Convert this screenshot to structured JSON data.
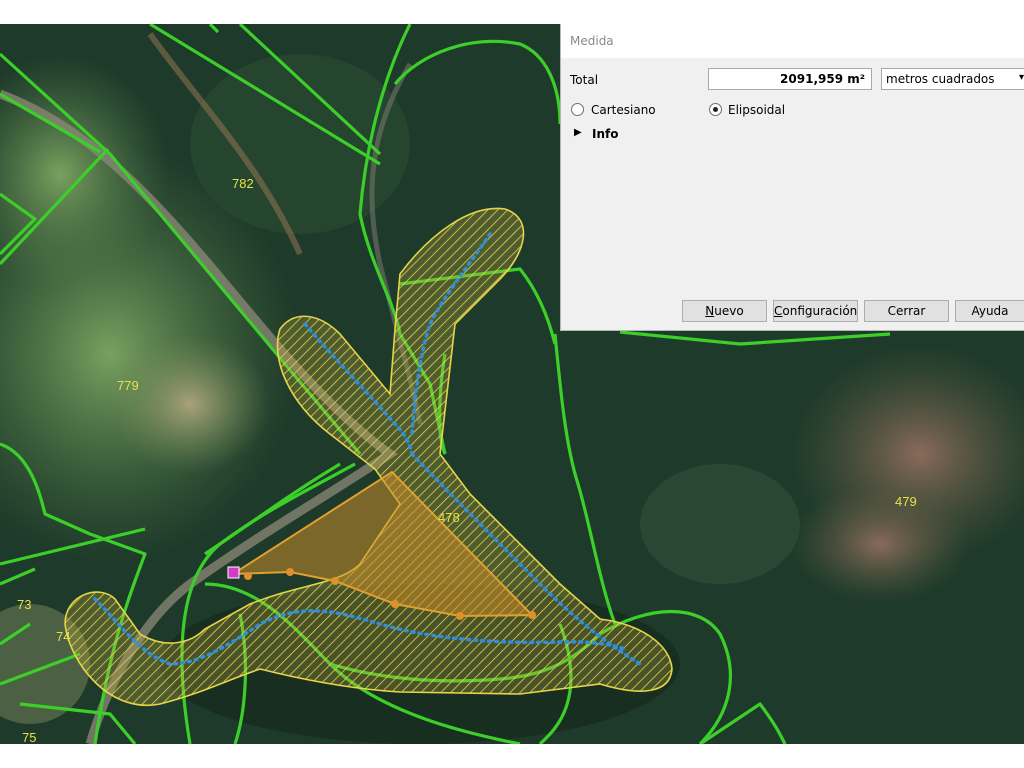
{
  "map": {
    "parcel_labels": [
      "782",
      "779",
      "478",
      "479",
      "73",
      "74",
      "75"
    ]
  },
  "dialog": {
    "title": "Medida",
    "total_label": "Total",
    "total_value": "2091,959 m²",
    "unit_selected": "metros cuadrados",
    "radio_cartesian": "Cartesiano",
    "radio_ellipsoidal": "Elipsoidal",
    "selected_mode": "Elipsoidal",
    "info_label": "Info",
    "buttons": {
      "new": {
        "mnemonic": "N",
        "rest": "uevo"
      },
      "config": {
        "mnemonic": "C",
        "rest": "onfiguración"
      },
      "close": "Cerrar",
      "help": "Ayuda"
    }
  },
  "colors": {
    "parcel_line": "#3ccf2a",
    "buffer_fill": "#d8c43c",
    "stream_dots": "#2f8fd8",
    "measure_polygon": "#d79a2a",
    "label": "#e8e24a"
  }
}
